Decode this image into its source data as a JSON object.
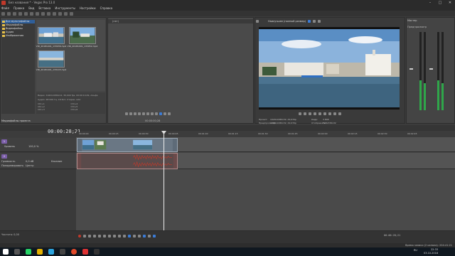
{
  "window": {
    "title": "Без названия * - Vegas Pro 13.0"
  },
  "window_controls": {
    "min": "–",
    "max": "□",
    "close": "✕"
  },
  "menu": [
    "Файл",
    "Правка",
    "Вид",
    "Вставка",
    "Инструменты",
    "Настройки",
    "Справка"
  ],
  "explorer": {
    "tree": [
      "Все мультифайлы",
      "Медиафайлы",
      "Видеофайлы",
      "Аудио",
      "Изображения"
    ],
    "clips": [
      {
        "caption": "VID_20181001_133036.mp4"
      },
      {
        "caption": "VID_20181001_133052.mp4"
      },
      {
        "caption": "VID_20181001_133103.mp4"
      }
    ],
    "props_line1": "Видео: 1920x1080x12, 30,000 fps, 00:00:14;29, Альфа",
    "props_line2": "Аудио: 48 000 Гц, 16 бит, Стерео, AAC",
    "props_grid": [
      "Ctrl+1",
      "Ctrl+4",
      "Ctrl+2",
      "Ctrl+5",
      "Ctrl+3",
      "Ctrl+6"
    ],
    "tab": "Медиафайлы проекта"
  },
  "trimmer": {
    "title": "(нет)",
    "time": "00:00:00;28"
  },
  "preview": {
    "mode": "Наилучшее (полный размер)",
    "info": [
      "Проект:",
      "1920x1080x32, 29,970p",
      "Кадр:",
      "3 848",
      "Предпросмотр:",
      "1920x1080x32, 29,970p",
      "Отображать:",
      "598x336x32"
    ]
  },
  "master": {
    "title": "Мастер",
    "level": "Предпросмотр"
  },
  "timeline": {
    "timecode": "00:00:28;21",
    "ruler": [
      "00:00:00",
      "00:00:15",
      "00:00:30",
      "00:00:45",
      "00:01:00",
      "00:01:15",
      "00:01:30",
      "00:01:45",
      "00:02:00",
      "00:02:15",
      "00:02:30",
      "00:02:45"
    ],
    "video_track": {
      "num": "1",
      "label": "Уровень",
      "value": "100,0 %"
    },
    "audio_track": {
      "num": "2",
      "volume_label": "Громкость",
      "volume_value": "0,0 dB",
      "pan_label": "Панорамировать",
      "pan_value": "Центр",
      "touch": "Касание"
    }
  },
  "bottom": {
    "rate": "Частота: 0,00",
    "time": "00:00:28;21",
    "status": "Время записи (2 канала): 204:41:21"
  },
  "taskbar": {
    "lang": "RU",
    "time": "22:33",
    "date": "03.10.2018"
  },
  "colors": {
    "video_track": "#7b5ea8",
    "audio_track": "#7b5ea8",
    "meter": "#2fa64a",
    "playhead": "#eeeeee"
  }
}
